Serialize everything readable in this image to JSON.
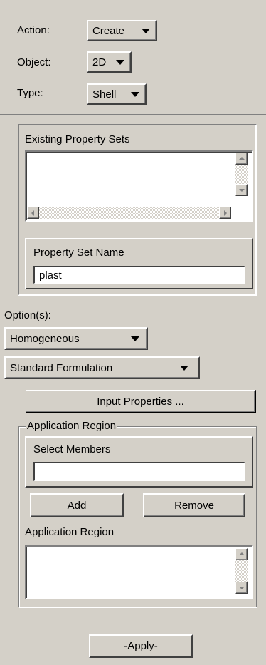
{
  "action": {
    "label": "Action:",
    "value": "Create"
  },
  "object": {
    "label": "Object:",
    "value": "2D"
  },
  "type": {
    "label": "Type:",
    "value": "Shell"
  },
  "existing_sets": {
    "title": "Existing Property Sets",
    "items": []
  },
  "property_set_name": {
    "title": "Property Set Name",
    "value": "plast"
  },
  "options": {
    "label": "Option(s):",
    "option1": "Homogeneous",
    "option2": "Standard Formulation"
  },
  "input_properties_label": "Input Properties ...",
  "application_region": {
    "group_title": "Application Region",
    "select_members_title": "Select Members",
    "select_members_value": "",
    "add_label": "Add",
    "remove_label": "Remove",
    "list_title": "Application Region",
    "items": []
  },
  "apply_label": "-Apply-"
}
